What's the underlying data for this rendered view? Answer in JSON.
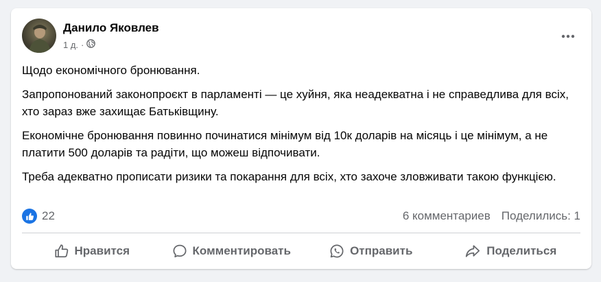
{
  "post": {
    "author": "Данило Яковлев",
    "timestamp": "1 д.",
    "visibility_icon": "globe-icon",
    "more_icon": "more-horizontal-icon",
    "paragraphs": [
      "Щодо економічного бронювання.",
      "Запропонований законопроєкт в парламенті — це хуйня, яка неадекватна і не справедлива для всіх, хто зараз вже захищає Батьківщину.",
      "Економічне бронювання повинно починатися мінімум від 10к доларів на місяць і це мінімум, а не платити 500 доларів та радіти, що можеш відпочивати.",
      "Треба адекватно прописати ризики та покарання для всіх, хто захоче зловживати такою функцією."
    ]
  },
  "stats": {
    "reaction_icon": "like-icon",
    "reaction_count": "22",
    "comments": "6 комментариев",
    "shares": "Поделились: 1"
  },
  "actions": {
    "like": "Нравится",
    "comment": "Комментировать",
    "send": "Отправить",
    "share": "Поделиться"
  },
  "colors": {
    "accent": "#1b74e4",
    "secondary_text": "#65676b",
    "page_bg": "#f0f2f5"
  }
}
